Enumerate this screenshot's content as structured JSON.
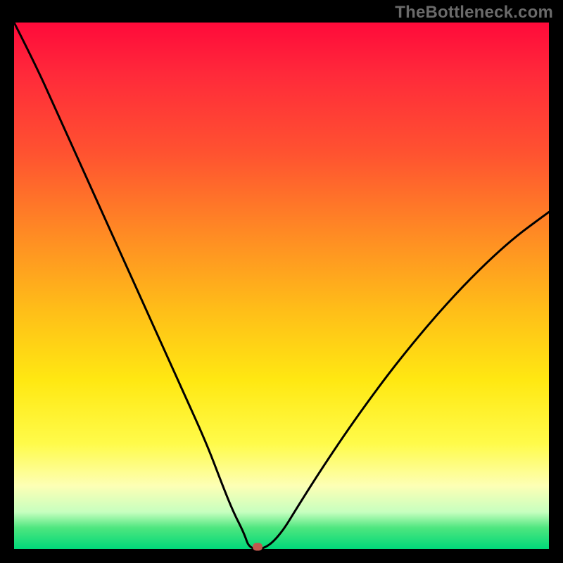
{
  "watermark": "TheBottleneck.com",
  "chart_data": {
    "type": "line",
    "title": "",
    "xlabel": "",
    "ylabel": "",
    "xlim": [
      0,
      100
    ],
    "ylim": [
      0,
      100
    ],
    "grid": false,
    "series": [
      {
        "name": "curve",
        "x": [
          0,
          4,
          8,
          12,
          16,
          20,
          24,
          28,
          32,
          36,
          39,
          41,
          43,
          44,
          47,
          50,
          53,
          58,
          64,
          72,
          82,
          92,
          100
        ],
        "y": [
          100,
          92,
          83,
          74,
          65,
          56,
          47,
          38,
          29,
          20,
          12,
          7,
          3,
          0,
          0,
          3,
          8,
          16,
          25,
          36,
          48,
          58,
          64
        ]
      }
    ],
    "marker": {
      "x": 45.5,
      "y": 0
    },
    "background_gradient": {
      "direction": "vertical",
      "stops": [
        {
          "pos": 0,
          "color": "#ff0a3a"
        },
        {
          "pos": 25,
          "color": "#ff5330"
        },
        {
          "pos": 55,
          "color": "#ffbf18"
        },
        {
          "pos": 80,
          "color": "#fffb4a"
        },
        {
          "pos": 96,
          "color": "#4ee67f"
        },
        {
          "pos": 100,
          "color": "#00d879"
        }
      ]
    }
  }
}
